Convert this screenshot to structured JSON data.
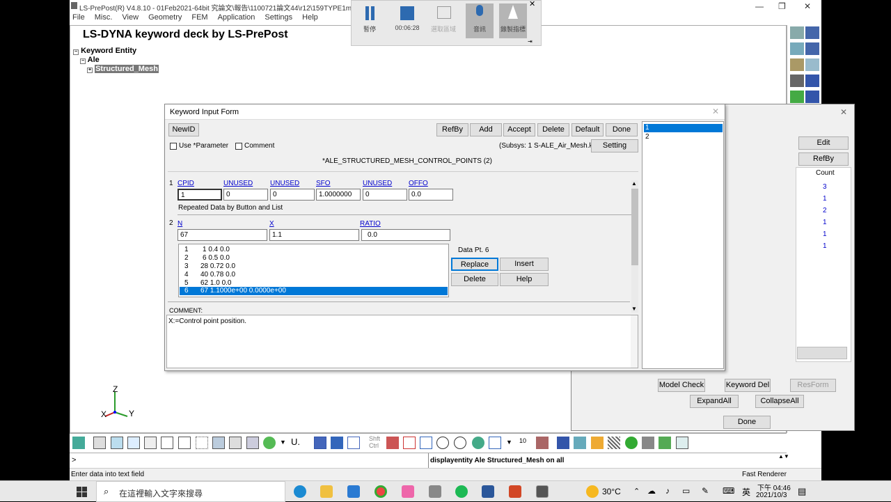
{
  "window": {
    "title": "LS-PrePost(R) V4.8.10 - 01Feb2021-64bit 究論文\\報告\\1100721論文44\\r12\\159TYPE1ms",
    "controls": [
      "—",
      "❐",
      "✕"
    ]
  },
  "menu": [
    "File",
    "Misc.",
    "View",
    "Geometry",
    "FEM",
    "Application",
    "Settings",
    "Help"
  ],
  "recorder": {
    "pause_label": "暫停",
    "stop_label": "00:06:28",
    "select_label": "選取區域",
    "audio_label": "音訊",
    "pointer_label": "錄製指標"
  },
  "deck": {
    "title": "LS-DYNA keyword deck by LS-PrePost",
    "tree": [
      "Keyword Entity",
      "Ale",
      "Structured_Mesh"
    ]
  },
  "kwform": {
    "title": "Keyword Input Form",
    "buttons": {
      "newid": "NewID",
      "refby": "RefBy",
      "add": "Add",
      "accept": "Accept",
      "delete": "Delete",
      "default": "Default",
      "done": "Done",
      "setting": "Setting"
    },
    "use_parameter": "Use *Parameter",
    "comment_chk": "Comment",
    "subsys": "(Subsys: 1 S-ALE_Air_Mesh.k)",
    "keyword": "*ALE_STRUCTURED_MESH_CONTROL_POINTS   (2)",
    "card1": {
      "num": "1",
      "headers": [
        "CPID",
        "UNUSED",
        "UNUSED",
        "SFO",
        "UNUSED",
        "OFFO"
      ],
      "values": [
        "1",
        "0",
        "0",
        "1.0000000",
        "0",
        "0.0"
      ]
    },
    "repeated_label": "Repeated Data by Button and List",
    "card2": {
      "num": "2",
      "headers": [
        "N",
        "X",
        "RATIO"
      ],
      "values": [
        "67",
        "1.1",
        "0.0"
      ]
    },
    "rows": [
      {
        "i": "1",
        "text": "1 0.4   0.0"
      },
      {
        "i": "2",
        "text": "6 0.5   0.0"
      },
      {
        "i": "3",
        "text": "28 0.72   0.0"
      },
      {
        "i": "4",
        "text": "40 0.78   0.0"
      },
      {
        "i": "5",
        "text": "62 1.0   0.0"
      },
      {
        "i": "6",
        "text": "67 1.1000e+00 0.0000e+00"
      }
    ],
    "data_pt": "Data Pt.   6",
    "list_buttons": {
      "replace": "Replace",
      "insert": "Insert",
      "delete": "Delete",
      "help": "Help"
    },
    "comment_heading": "COMMENT:",
    "comment_text": "X:=Control point position.",
    "id_list": [
      "1",
      "2"
    ]
  },
  "kwmgr": {
    "edit": "Edit",
    "refby": "RefBy",
    "count_header": "Count",
    "counts": [
      "3",
      "1",
      "2",
      "1",
      "1",
      "1"
    ],
    "model_check": "Model Check",
    "keyword_del": "Keyword Del",
    "resform": "ResForm",
    "expand_all": "ExpandAll",
    "collapse_all": "CollapseAll",
    "done": "Done"
  },
  "bottom": {
    "shft_ctrl": "Shft Ctrl",
    "num10": "10",
    "u_label": "U."
  },
  "cmd": {
    "prompt": ">",
    "output": "displayentity Ale Structured_Mesh on all"
  },
  "status": {
    "left": "Enter data into text field",
    "right": "Fast Renderer"
  },
  "taskbar": {
    "search_placeholder": "在這裡輸入文字來搜尋",
    "weather": "30°C",
    "ime": "英",
    "time": "下午 04:46",
    "date": "2021/10/3"
  },
  "axis": {
    "z": "Z",
    "x": "X",
    "y": "Y"
  },
  "colors": {
    "selection": "#0078d7",
    "link": "#0000cc",
    "count_blue": "#0000cc"
  }
}
